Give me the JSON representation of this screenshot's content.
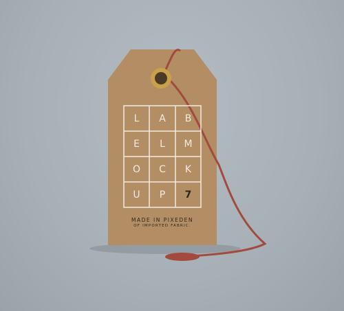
{
  "tag": {
    "grid_letters": [
      "L",
      "A",
      "B",
      "E",
      "L",
      "M",
      "O",
      "C",
      "K",
      "U",
      "P",
      "7"
    ],
    "line1": "MADE IN PIXEDEN",
    "line2": "OF IMPORTED FABRIC."
  },
  "colors": {
    "background": "#a9b2b8",
    "tag": "#b38d63",
    "string": "#a34a3f",
    "eyelet": "#c9a14a"
  }
}
